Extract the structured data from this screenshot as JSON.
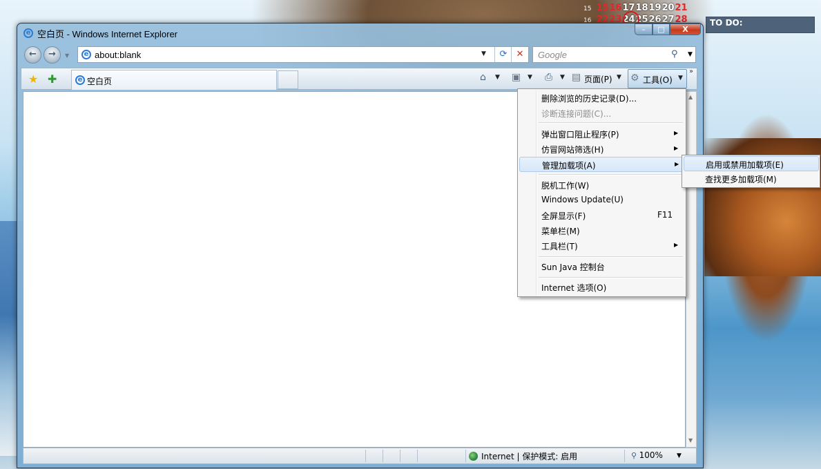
{
  "desktop": {
    "calendar": {
      "row1": {
        "week": "15",
        "days": [
          "15",
          "16",
          "17",
          "18",
          "19",
          "20",
          "21"
        ]
      },
      "row2": {
        "week": "16",
        "days": [
          "22",
          "23",
          "24",
          "25",
          "26",
          "27",
          "28"
        ]
      },
      "today": "24"
    },
    "todo_label": "TO DO:"
  },
  "window": {
    "title": "空白页 - Windows Internet Explorer",
    "caption": {
      "minimize": "–",
      "maximize": "□",
      "close": "X"
    },
    "address": {
      "value": "about:blank",
      "refresh_icon": "⟳",
      "stop_icon": "✕"
    },
    "search": {
      "placeholder": "Google"
    },
    "tab": {
      "title": "空白页"
    },
    "commands": {
      "page_label": "页面(P)",
      "tools_label": "工具(O)"
    },
    "status": {
      "zone": "Internet | 保护模式: 启用",
      "zoom": "100%"
    }
  },
  "tools_menu": {
    "items": [
      {
        "label": "删除浏览的历史记录(D)...",
        "enabled": true
      },
      {
        "label": "诊断连接问题(C)...",
        "enabled": false
      },
      {
        "label": "弹出窗口阻止程序(P)",
        "submenu": true
      },
      {
        "label": "仿冒网站筛选(H)",
        "submenu": true
      },
      {
        "label": "管理加载项(A)",
        "submenu": true,
        "highlighted": true
      },
      {
        "label": "脱机工作(W)"
      },
      {
        "label": "Windows Update(U)"
      },
      {
        "label": "全屏显示(F)",
        "shortcut": "F11"
      },
      {
        "label": "菜单栏(M)"
      },
      {
        "label": "工具栏(T)",
        "submenu": true
      },
      {
        "label": "Sun Java 控制台"
      },
      {
        "label": "Internet 选项(O)"
      }
    ]
  },
  "addons_submenu": {
    "items": [
      {
        "label": "启用或禁用加载项(E)",
        "highlighted": true
      },
      {
        "label": "查找更多加载项(M)"
      }
    ]
  },
  "icons": {
    "back": "back-arrow-icon",
    "forward": "forward-arrow-icon",
    "favorites": "star-icon",
    "add_favorites": "star-plus-icon",
    "home": "home-icon",
    "feeds": "rss-icon",
    "print": "printer-icon",
    "page": "page-icon",
    "tools": "gear-icon",
    "search": "magnifier-icon",
    "zone": "globe-icon",
    "zoom": "zoom-icon"
  },
  "colors": {
    "menu_highlight": "#d7e7f8",
    "close_button": "#c43b1f",
    "today_ring": "#d81b1b"
  }
}
